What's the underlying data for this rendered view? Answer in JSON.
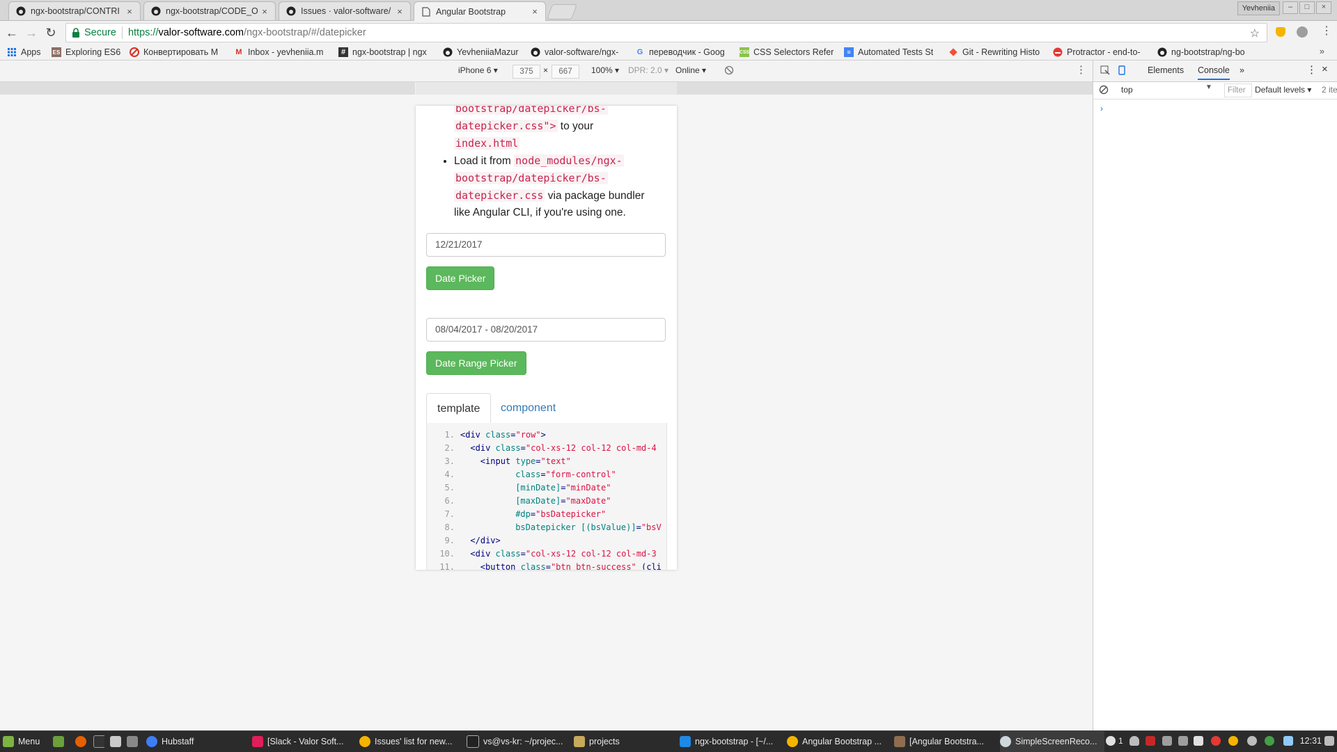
{
  "tabs": [
    {
      "title": "ngx-bootstrap/CONTRI",
      "icon": "github-icon"
    },
    {
      "title": "ngx-bootstrap/CODE_O",
      "icon": "github-icon"
    },
    {
      "title": "Issues · valor-software/",
      "icon": "github-icon"
    },
    {
      "title": "Angular Bootstrap",
      "icon": "page-icon"
    }
  ],
  "tab_close_glyph": "×",
  "profile_name": "Yevheniia",
  "omnibox": {
    "secure_label": "Secure",
    "url_scheme": "https://",
    "url_host": "valor-software.com",
    "url_path": "/ngx-bootstrap/#/datepicker"
  },
  "bookmarks": [
    {
      "label": "Apps",
      "icon": "apps-grid-icon"
    },
    {
      "label": "Exploring ES6",
      "icon": "book-icon"
    },
    {
      "label": "Конвертировать М",
      "icon": "convert-icon"
    },
    {
      "label": "Inbox - yevheniia.m",
      "icon": "gmail-icon"
    },
    {
      "label": "ngx-bootstrap | ngx",
      "icon": "hash-icon"
    },
    {
      "label": "YevheniiaMazur",
      "icon": "github-icon"
    },
    {
      "label": "valor-software/ngx-",
      "icon": "github-icon"
    },
    {
      "label": "переводчик - Goog",
      "icon": "google-icon"
    },
    {
      "label": "CSS Selectors Refer",
      "icon": "css-icon"
    },
    {
      "label": "Automated Tests St",
      "icon": "doc-icon"
    },
    {
      "label": "Git - Rewriting Histo",
      "icon": "git-icon"
    },
    {
      "label": "Protractor - end-to-",
      "icon": "protractor-icon"
    },
    {
      "label": "ng-bootstrap/ng-bo",
      "icon": "github-icon"
    }
  ],
  "bookmarks_more": "»",
  "device_toolbar": {
    "device": "iPhone 6",
    "width": "375",
    "times": "×",
    "height": "667",
    "zoom": "100%",
    "dpr": "DPR: 2.0",
    "network": "Online"
  },
  "page": {
    "bullet_1_code_a": "bootstrap/datepicker/bs-",
    "bullet_1_code_b": "datepicker.css\">",
    "bullet_1_text_a": " to your",
    "bullet_1_code_c": "index.html",
    "bullet_2_text_a": "Load it from ",
    "bullet_2_code_a": "node_modules/ngx-",
    "bullet_2_code_b": "bootstrap/datepicker/bs-",
    "bullet_2_code_c": "datepicker.css",
    "bullet_2_text_b": " via package bundler",
    "bullet_2_text_c": "like Angular CLI, if you're using one.",
    "date_value": "12/21/2017",
    "date_button": "Date Picker",
    "range_value": "08/04/2017 - 08/20/2017",
    "range_button": "Date Range Picker",
    "tab_template": "template",
    "tab_component": "component"
  },
  "code_lines": [
    {
      "n": "1.",
      "indent": 0,
      "parts": [
        [
          "t",
          "<div "
        ],
        [
          "a",
          "class"
        ],
        [
          "t",
          "="
        ],
        [
          "s",
          "\"row\""
        ],
        [
          "t",
          ">"
        ]
      ]
    },
    {
      "n": "2.",
      "indent": 2,
      "parts": [
        [
          "t",
          "<div "
        ],
        [
          "a",
          "class"
        ],
        [
          "t",
          "="
        ],
        [
          "s",
          "\"col-xs-12 col-12 col-md-4"
        ]
      ]
    },
    {
      "n": "3.",
      "indent": 4,
      "parts": [
        [
          "t",
          "<input "
        ],
        [
          "a",
          "type"
        ],
        [
          "t",
          "="
        ],
        [
          "s",
          "\"text\""
        ]
      ]
    },
    {
      "n": "4.",
      "indent": 11,
      "parts": [
        [
          "a",
          "class"
        ],
        [
          "t",
          "="
        ],
        [
          "s",
          "\"form-control\""
        ]
      ]
    },
    {
      "n": "5.",
      "indent": 11,
      "parts": [
        [
          "a",
          "[minDate]"
        ],
        [
          "t",
          "="
        ],
        [
          "s",
          "\"minDate\""
        ]
      ]
    },
    {
      "n": "6.",
      "indent": 11,
      "parts": [
        [
          "a",
          "[maxDate]"
        ],
        [
          "t",
          "="
        ],
        [
          "s",
          "\"maxDate\""
        ]
      ]
    },
    {
      "n": "7.",
      "indent": 11,
      "parts": [
        [
          "a",
          "#dp"
        ],
        [
          "t",
          "="
        ],
        [
          "s",
          "\"bsDatepicker\""
        ]
      ]
    },
    {
      "n": "8.",
      "indent": 11,
      "parts": [
        [
          "a",
          "bsDatepicker [(bsValue)]"
        ],
        [
          "t",
          "="
        ],
        [
          "s",
          "\"bsV"
        ]
      ]
    },
    {
      "n": "9.",
      "indent": 2,
      "parts": [
        [
          "t",
          "</div>"
        ]
      ]
    },
    {
      "n": "10.",
      "indent": 2,
      "parts": [
        [
          "t",
          "<div "
        ],
        [
          "a",
          "class"
        ],
        [
          "t",
          "="
        ],
        [
          "s",
          "\"col-xs-12 col-12 col-md-3"
        ]
      ]
    },
    {
      "n": "11.",
      "indent": 4,
      "parts": [
        [
          "t",
          "<button "
        ],
        [
          "a",
          "class"
        ],
        [
          "t",
          "="
        ],
        [
          "s",
          "\"btn btn-success\""
        ],
        [
          "t",
          " (cli"
        ]
      ]
    }
  ],
  "devtools": {
    "tab_elements": "Elements",
    "tab_console": "Console",
    "more": "»",
    "context": "top",
    "filter_placeholder": "Filter",
    "levels": "Default levels",
    "count": "2 ite",
    "prompt": "›"
  },
  "taskbar": [
    {
      "label": "Menu",
      "icon": "menu-icon"
    },
    {
      "label": "Hubstaff",
      "icon": "hubstaff-icon"
    },
    {
      "label": "[Slack - Valor Soft...",
      "icon": "slack-icon"
    },
    {
      "label": "Issues' list for new...",
      "icon": "chrome-icon"
    },
    {
      "label": "vs@vs-kr: ~/projec...",
      "icon": "terminal-icon"
    },
    {
      "label": "projects",
      "icon": "folder-icon"
    },
    {
      "label": "ngx-bootstrap - [~/...",
      "icon": "webstorm-icon"
    },
    {
      "label": "Angular Bootstrap ...",
      "icon": "chrome-icon"
    },
    {
      "label": "[Angular Bootstra...",
      "icon": "screenshot-icon"
    },
    {
      "label": "SimpleScreenReco...",
      "icon": "recorder-icon"
    }
  ],
  "tray_number": "1",
  "clock": "12:31",
  "colors": {
    "success": "#5cb85c",
    "link": "#337ab7",
    "code_red": "#c7254e",
    "secure_green": "#0b8043"
  }
}
